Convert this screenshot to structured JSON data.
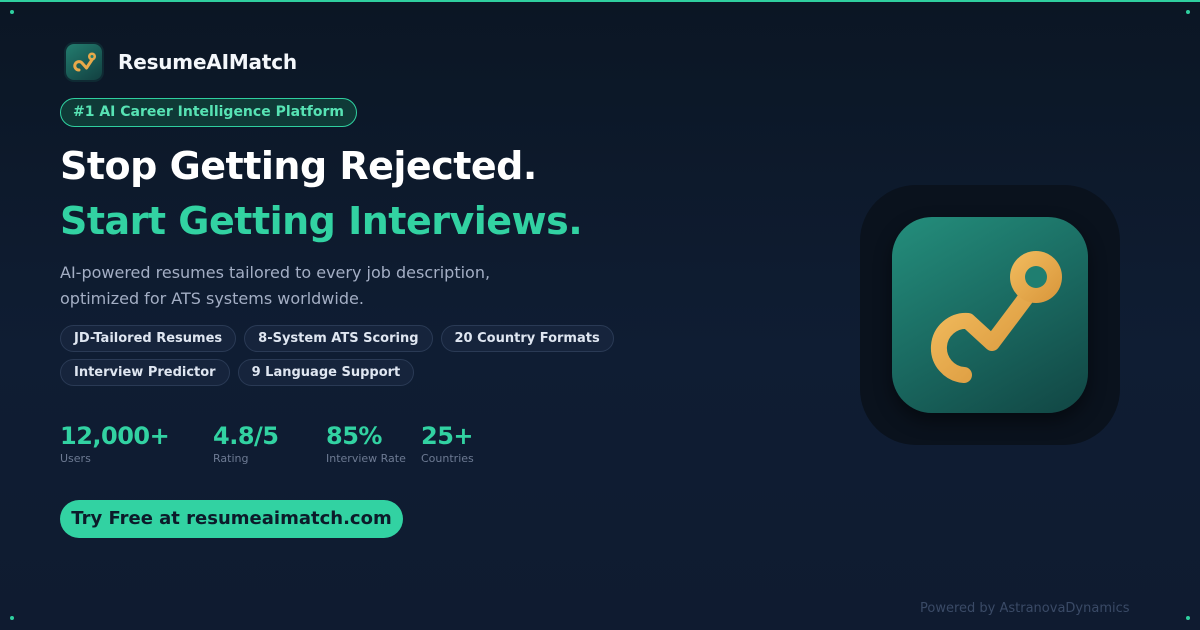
{
  "brand": {
    "name": "ResumeAIMatch",
    "logo_icon": "path-link-icon"
  },
  "badge": "#1 AI Career Intelligence Platform",
  "headline": {
    "line1": "Stop Getting Rejected.",
    "line2": "Start Getting Interviews."
  },
  "subtext": {
    "line1": "AI-powered resumes tailored to every job description,",
    "line2": "optimized for ATS systems worldwide."
  },
  "features": [
    "JD-Tailored Resumes",
    "8-System ATS Scoring",
    "20 Country Formats",
    "Interview Predictor",
    "9 Language Support"
  ],
  "stats": [
    {
      "value": "12,000+",
      "label": "Users"
    },
    {
      "value": "4.8/5",
      "label": "Rating"
    },
    {
      "value": "85%",
      "label": "Interview Rate"
    },
    {
      "value": "25+",
      "label": "Countries"
    }
  ],
  "cta": "Try Free at resumeaimatch.com",
  "footer": "Powered by AstranovaDynamics",
  "hero": {
    "icon": "path-link-icon"
  },
  "colors": {
    "accent": "#32d2a2",
    "background": "#0f1d33",
    "icon_gold": "#e8a94a",
    "icon_teal": "#1f7e70"
  }
}
